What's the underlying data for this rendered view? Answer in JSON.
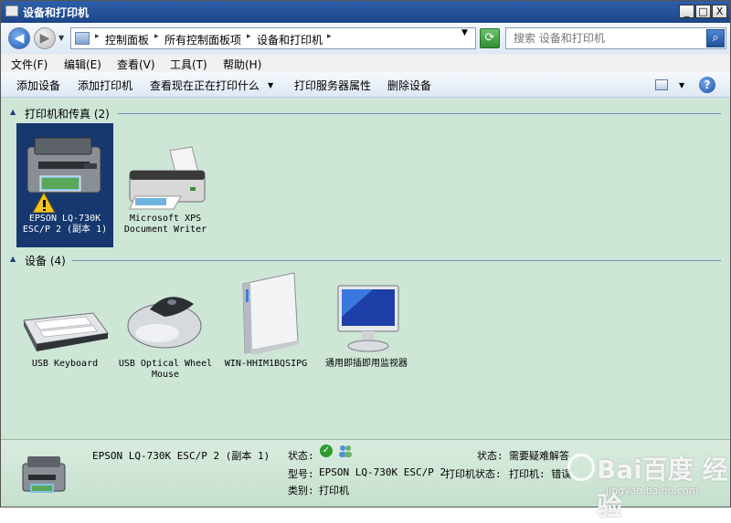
{
  "window": {
    "title": "设备和打印机",
    "controls": {
      "minimize": "_",
      "maximize": "□",
      "close": "X"
    }
  },
  "address_bar": {
    "breadcrumbs": [
      "控制面板",
      "所有控制面板项",
      "设备和打印机"
    ],
    "search_placeholder": "搜索 设备和打印机"
  },
  "menu": [
    "文件(F)",
    "编辑(E)",
    "查看(V)",
    "工具(T)",
    "帮助(H)"
  ],
  "commands": [
    "添加设备",
    "添加打印机",
    "查看现在正在打印什么",
    "打印服务器属性",
    "删除设备"
  ],
  "groups": {
    "printers": {
      "title": "打印机和传真 (2)",
      "items": [
        {
          "name": "EPSON LQ-730K ESC/P 2 (副本 1)",
          "icon": "printer-warning-icon",
          "selected": true
        },
        {
          "name": "Microsoft XPS Document Writer",
          "icon": "xps-printer-icon",
          "selected": false
        }
      ]
    },
    "devices": {
      "title": "设备 (4)",
      "items": [
        {
          "name": "USB Keyboard",
          "icon": "keyboard-icon"
        },
        {
          "name": "USB Optical Wheel Mouse",
          "icon": "mouse-icon"
        },
        {
          "name": "WIN-HHIM1BQSIPG",
          "icon": "computer-tower-icon"
        },
        {
          "name": "通用即插即用监视器",
          "icon": "monitor-icon"
        }
      ]
    }
  },
  "details": {
    "device_name": "EPSON LQ-730K ESC/P 2 (副本 1)",
    "status_label": "状态:",
    "model_label": "型号:",
    "model_value": "EPSON LQ-730K ESC/P 2",
    "category_label": "类别:",
    "category_value": "打印机",
    "right_status_label": "状态:",
    "right_status_value": "需要疑难解答",
    "printer_status_label": "打印机状态:",
    "printer_status_value": "打印机: 错误"
  },
  "watermark": {
    "brand": "Bai百度 经验",
    "url": "jingyan.baidu.com"
  },
  "colors": {
    "titlebar": "#1c4588",
    "content_bg": "#cde6d6",
    "selection": "#17376f"
  }
}
